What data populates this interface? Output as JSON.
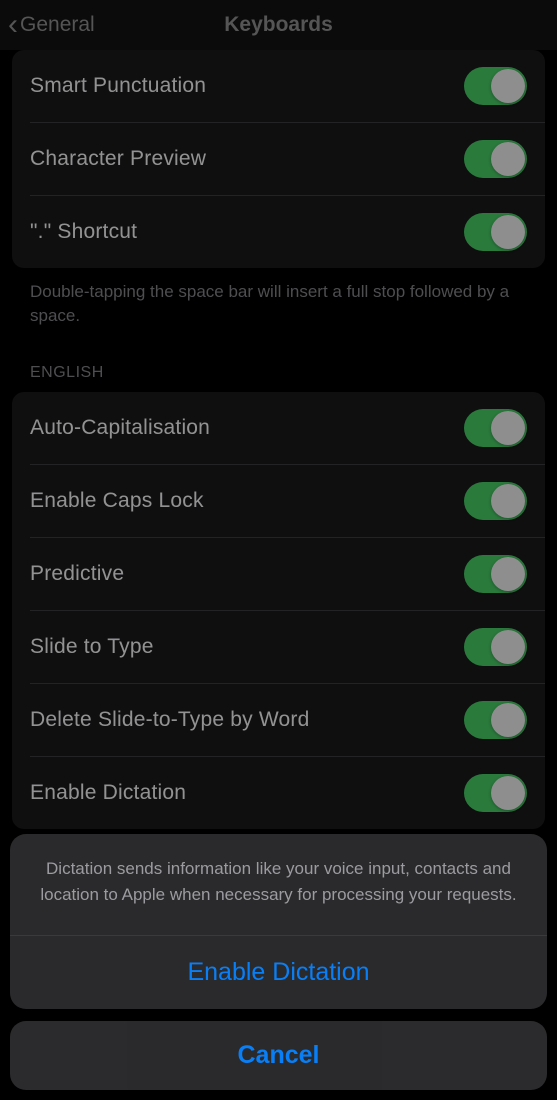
{
  "nav": {
    "back_label": "General",
    "title": "Keyboards"
  },
  "section1": {
    "items": [
      {
        "label": "Smart Punctuation"
      },
      {
        "label": "Character Preview"
      },
      {
        "label": "\".\" Shortcut"
      }
    ],
    "footer": "Double-tapping the space bar will insert a full stop followed by a space."
  },
  "section2": {
    "header": "ENGLISH",
    "items": [
      {
        "label": "Auto-Capitalisation"
      },
      {
        "label": "Enable Caps Lock"
      },
      {
        "label": "Predictive"
      },
      {
        "label": "Slide to Type"
      },
      {
        "label": "Delete Slide-to-Type by Word"
      },
      {
        "label": "Enable Dictation"
      }
    ]
  },
  "action_sheet": {
    "message": "Dictation sends information like your voice input, contacts and location to Apple when necessary for processing your requests.",
    "primary": "Enable Dictation",
    "cancel": "Cancel"
  }
}
